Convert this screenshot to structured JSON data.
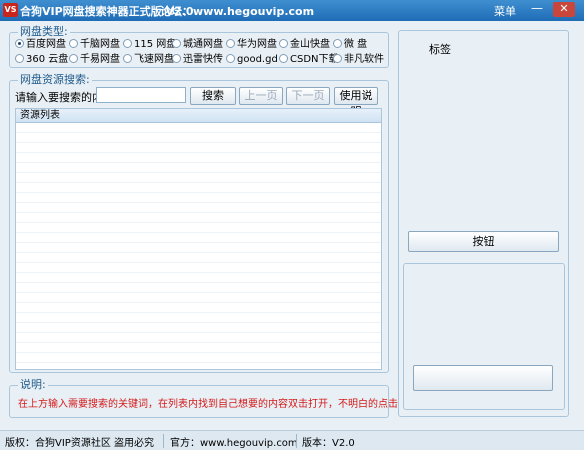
{
  "window": {
    "icon_text": "VS",
    "title": "合狗VIP网盘搜索神器正式版 V2.0",
    "forum": "论坛：www.hegouvip.com",
    "menu_label": "菜单",
    "minimize_symbol": "—",
    "close_symbol": "✕"
  },
  "disk_type": {
    "title": "网盘类型:",
    "options": [
      {
        "label": "百度网盘",
        "selected": true
      },
      {
        "label": "千脑网盘",
        "selected": false
      },
      {
        "label": "115 网盘",
        "selected": false
      },
      {
        "label": "城通网盘",
        "selected": false
      },
      {
        "label": "华为网盘",
        "selected": false
      },
      {
        "label": "金山快盘",
        "selected": false
      },
      {
        "label": "微    盘",
        "selected": false
      },
      {
        "label": "360 云盘",
        "selected": false
      },
      {
        "label": "千易网盘",
        "selected": false
      },
      {
        "label": "飞速网盘",
        "selected": false
      },
      {
        "label": "迅雷快传",
        "selected": false
      },
      {
        "label": "good.gd",
        "selected": false
      },
      {
        "label": "CSDN下载",
        "selected": false
      },
      {
        "label": "非凡软件",
        "selected": false
      }
    ]
  },
  "search": {
    "title": "网盘资源搜索:",
    "prompt": "请输入要搜索的内容:",
    "value": "",
    "search_button": "搜索",
    "prev_button": "上一页",
    "next_button": "下一页",
    "help_button": "使用说明"
  },
  "resource_list": {
    "header": "资源列表"
  },
  "notes": {
    "title": "说明:",
    "text": "在上方输入需要搜索的关键词，在列表内找到自己想要的内容双击打开，不明白的点击上面使用说明"
  },
  "right_panel": {
    "label": "标签",
    "button": "按钮",
    "bottom_button": ""
  },
  "status": {
    "copyright": "版权：合狗VIP资源社区   盗用必究",
    "official": "官方：www.hegouvip.com",
    "version": "版本：V2.0"
  }
}
